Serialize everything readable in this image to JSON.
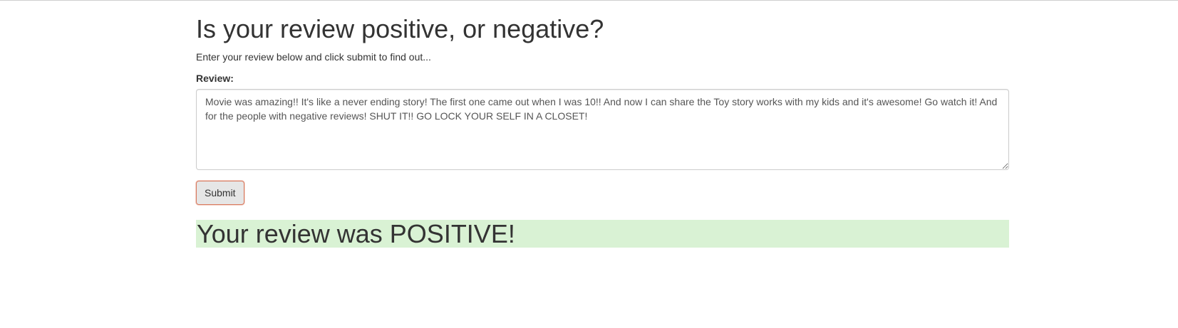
{
  "page": {
    "title": "Is your review positive, or negative?",
    "intro": "Enter your review below and click submit to find out..."
  },
  "form": {
    "review_label": "Review:",
    "review_value": "Movie was amazing!! It's like a never ending story! The first one came out when I was 10!! And now I can share the Toy story works with my kids and it's awesome! Go watch it! And for the people with negative reviews! SHUT IT!! GO LOCK YOUR SELF IN A CLOSET!",
    "submit_label": "Submit"
  },
  "result": {
    "text": "Your review was POSITIVE!",
    "background_color": "#d9f2d4"
  },
  "colors": {
    "text": "#333333",
    "button_border": "#d9795e",
    "button_bg": "#e6e6e6"
  }
}
